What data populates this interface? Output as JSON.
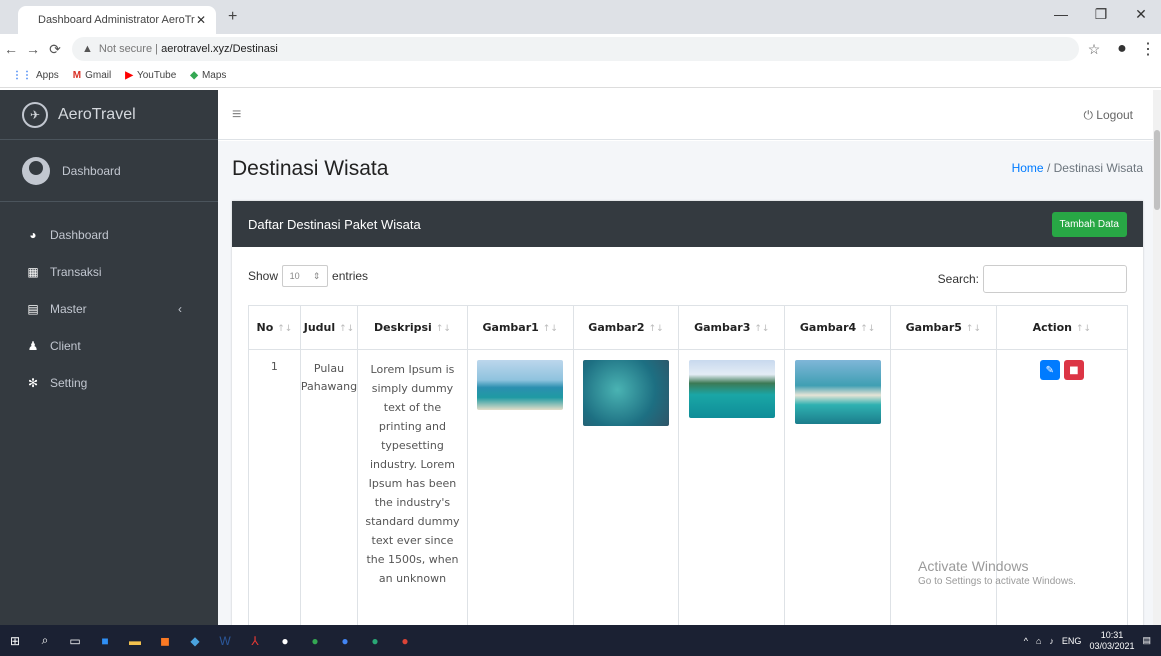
{
  "browser": {
    "tab_title": "Dashboard Administrator AeroTr",
    "tab_close": "✕",
    "new_tab": "+",
    "url_warning": "Not secure",
    "url": "aerotravel.xyz/Destinasi",
    "bookmarks": [
      "Apps",
      "Gmail",
      "YouTube",
      "Maps"
    ],
    "window_buttons": [
      "—",
      "❐",
      "✕"
    ]
  },
  "sidebar": {
    "brand": "AeroTravel",
    "user": "Dashboard",
    "items": [
      {
        "label": "Dashboard",
        "icon": "dashboard-icon"
      },
      {
        "label": "Transaksi",
        "icon": "table-icon"
      },
      {
        "label": "Master",
        "icon": "book-icon"
      },
      {
        "label": "Client",
        "icon": "users-icon"
      },
      {
        "label": "Setting",
        "icon": "gear-icon"
      }
    ]
  },
  "topnav": {
    "logout": "Logout"
  },
  "page": {
    "title": "Destinasi Wisata",
    "breadcrumb_home": "Home",
    "breadcrumb_sep": "/",
    "breadcrumb_current": "Destinasi Wisata"
  },
  "card": {
    "title": "Daftar Destinasi Paket Wisata",
    "add_button": "Tambah Data",
    "show_label": "Show",
    "entries_value": "10",
    "entries_label": "entries",
    "search_label": "Search:"
  },
  "table": {
    "headers": [
      "No",
      "Judul",
      "Deskripsi",
      "Gambar1",
      "Gambar2",
      "Gambar3",
      "Gambar4",
      "Gambar5",
      "Action"
    ],
    "rows": [
      {
        "no": "1",
        "judul": "Pulau Pahawang",
        "deskripsi": "Lorem Ipsum is simply dummy text of the printing and typesetting industry. Lorem Ipsum has been the industry's standard dummy text ever since the 1500s, when an unknown"
      }
    ]
  },
  "watermark": {
    "title": "Activate Windows",
    "subtitle": "Go to Settings to activate Windows."
  },
  "taskbar": {
    "lang": "ENG",
    "time": "10:31",
    "date": "03/03/2021"
  },
  "colors": {
    "sidebar": "#343a40",
    "accent_green": "#28a745",
    "edit_blue": "#007bff",
    "delete_red": "#dc3545"
  }
}
